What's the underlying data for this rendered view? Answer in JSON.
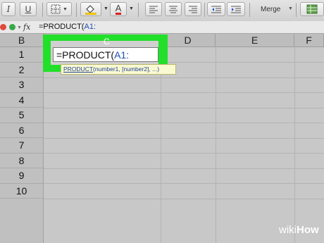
{
  "toolbar": {
    "italic_label": "I",
    "underline_label": "U",
    "font_color_label": "A",
    "merge_label": "Merge",
    "colors": {
      "fill": "#f2c200",
      "font_color": "#d92020"
    }
  },
  "formula_bar": {
    "fx_label": "fx",
    "formula_prefix": "=PRODUCT(",
    "formula_ref": "A1:"
  },
  "grid": {
    "columns": [
      "B",
      "C",
      "D",
      "E",
      "F"
    ],
    "rows": [
      "1",
      "2",
      "3",
      "4",
      "5",
      "6",
      "7",
      "8",
      "9",
      "10"
    ]
  },
  "active_cell": {
    "column_header": "C",
    "content_prefix": "=PRODUCT(",
    "content_ref": "A1:",
    "highlight_color": "#22e02a"
  },
  "tooltip": {
    "func": "PRODUCT",
    "args": "(number1, [number2], ...)"
  },
  "watermark": {
    "part1": "wiki",
    "part2": "How"
  }
}
